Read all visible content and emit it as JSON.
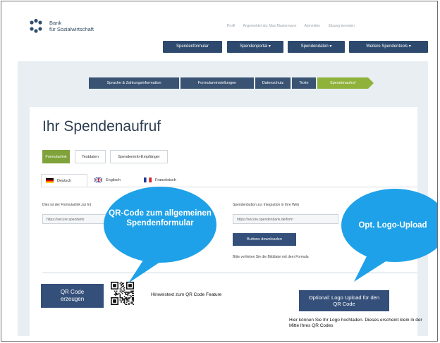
{
  "brand": {
    "line1": "Bank",
    "line2": "für Sozialwirtschaft"
  },
  "top_links": [
    "Profil",
    "Angemeldet als: Max Mustermann",
    "Abmelden",
    "Sitzung beenden"
  ],
  "nav": [
    "Spendenformular",
    "Spendenportal",
    "Spendendaten",
    "Weitere Spendentools"
  ],
  "steps": [
    "Sprache & Zahlungsinformation",
    "Formulareinstellungen",
    "Datenschutz",
    "Texte",
    "Spendenaufruf"
  ],
  "page_title": "Ihr Spendenaufruf",
  "tabs": [
    "Formularlink",
    "Testdaten",
    "Spendeninfo-Empfänger"
  ],
  "languages": [
    "Deutsch",
    "Englisch",
    "Französisch"
  ],
  "left_col": {
    "label": "Dies ist der Formularlink zur Int",
    "value": "https://secure.spendenb"
  },
  "right_col": {
    "label": "Spendenbutton zur Integration in Ihre Web",
    "value": "https://secure.spendenbank.de/form",
    "button": "Buttons downloaden",
    "note": "Bitte verlinken Sie die Bilddatei mit dem Formula"
  },
  "qr": {
    "button": "QR Code erzeugen",
    "hint": "Hinweistext zum QR Code Feature"
  },
  "logo_upload": {
    "button": "Optional: Logo Upload für den QR Code",
    "hint": "Hier können Sie Ihr Logo hochladen. Dieses erscheint klein in der Mitte Ihres QR Codes"
  },
  "callouts": {
    "qr": "QR-Code zum allgemeinen Spendenformular",
    "logo": "Opt. Logo-Upload"
  },
  "colors": {
    "nav_blue": "#2d4a6e",
    "active_green": "#8fb23a",
    "callout_blue": "#1ea1e8"
  }
}
